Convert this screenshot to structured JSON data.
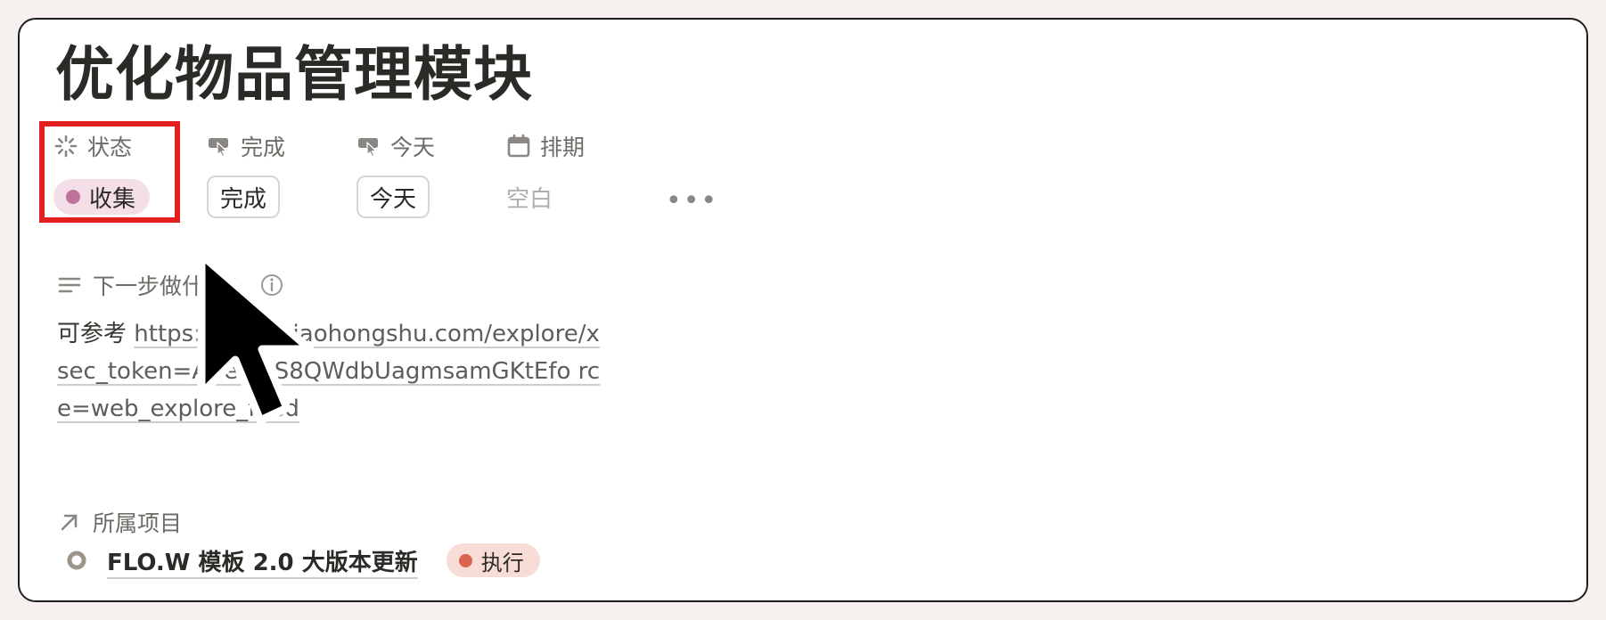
{
  "page": {
    "title": "优化物品管理模块"
  },
  "properties": {
    "status": {
      "label": "状态",
      "value": "收集",
      "icon": "loading-spinner-icon",
      "color": "#c0739a"
    },
    "done": {
      "label": "完成",
      "value": "完成",
      "icon": "click-button-icon"
    },
    "today": {
      "label": "今天",
      "value": "今天",
      "icon": "click-button-icon"
    },
    "schedule": {
      "label": "排期",
      "value": "空白",
      "icon": "calendar-icon"
    },
    "more": "•••"
  },
  "next_step": {
    "label": "下一步做什么?",
    "prefix": "可参考",
    "link": "https://www.xiaohongshu.com/explore/xsec_token=ABe78JS8QWdbUagmsamGKtEfo rce=web_explore_feed"
  },
  "project": {
    "label": "所属项目",
    "name": "FLO.W 模板 2.0 大版本更新",
    "status": "执行",
    "status_color": "#d9634f"
  }
}
